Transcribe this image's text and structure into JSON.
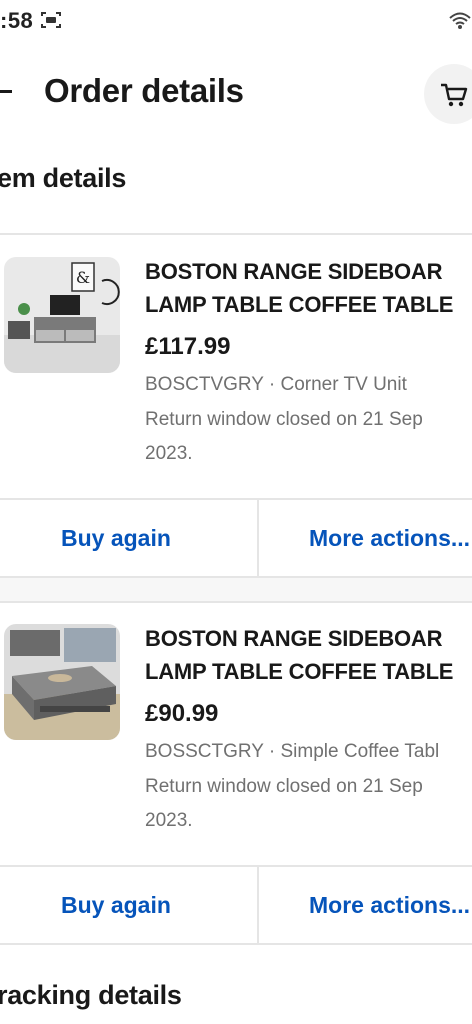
{
  "status_bar": {
    "time": ":58"
  },
  "header": {
    "title": "Order details"
  },
  "sections": {
    "item_details": "em details",
    "tracking_details": "racking details"
  },
  "items": [
    {
      "title_line1": "BOSTON RANGE SIDEBOAR",
      "title_line2": "LAMP TABLE COFFEE TABLE",
      "price": "£117.99",
      "meta": "BOSCTVGRY · Corner TV Unit",
      "return_note": "Return window closed on 21 Sep 2023.",
      "buy_again": "Buy again",
      "more_actions": "More actions..."
    },
    {
      "title_line1": "BOSTON RANGE SIDEBOAR",
      "title_line2": "LAMP TABLE COFFEE TABLE",
      "price": "£90.99",
      "meta": "BOSSCTGRY · Simple Coffee Tabl",
      "return_note": "Return window closed on 21 Sep 2023.",
      "buy_again": "Buy again",
      "more_actions": "More actions..."
    }
  ],
  "colors": {
    "link": "#0654ba",
    "muted_text": "#707070",
    "divider": "#e5e5e5"
  },
  "icons": [
    "screen-record-icon",
    "wifi-icon",
    "back-arrow-icon",
    "cart-icon"
  ]
}
